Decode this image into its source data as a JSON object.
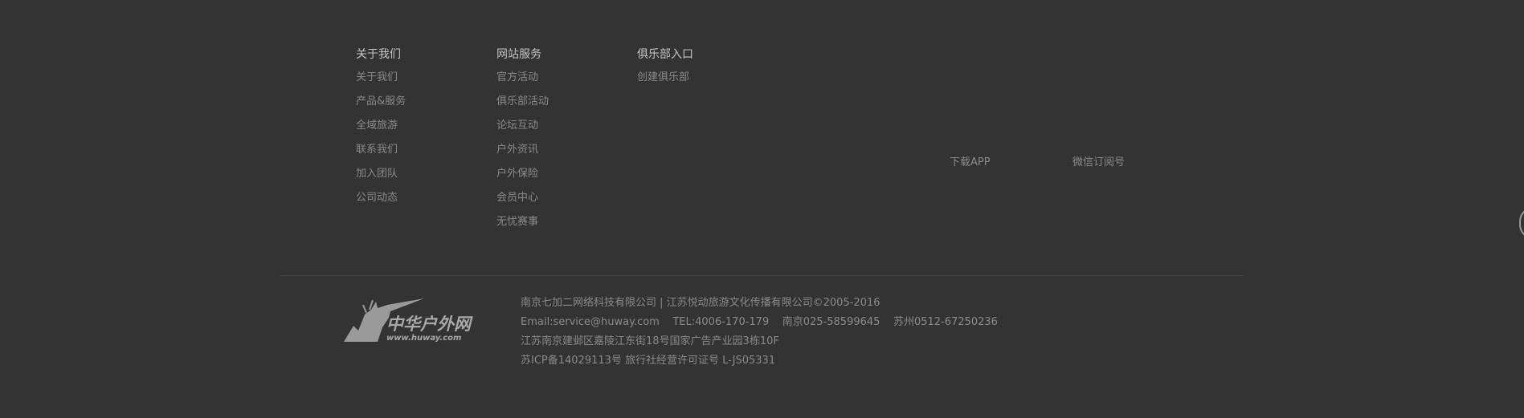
{
  "columns": {
    "about": {
      "title": "关于我们",
      "links": [
        "关于我们",
        "产品&服务",
        "全域旅游",
        "联系我们",
        "加入团队",
        "公司动态"
      ]
    },
    "service": {
      "title": "网站服务",
      "links": [
        "官方活动",
        "俱乐部活动",
        "论坛互动",
        "户外资讯",
        "户外保险",
        "会员中心",
        "无忧赛事"
      ]
    },
    "club": {
      "title": "俱乐部入口",
      "links": [
        "创建俱乐部"
      ]
    }
  },
  "apps": {
    "download": "下载APP",
    "wechat": "微信订阅号"
  },
  "logo": {
    "name": "中华户外网",
    "url": "www.huway.com"
  },
  "footer_info": {
    "company": "南京七加二网络科技有限公司 | 江苏悦动旅游文化传播有限公司©2005-2016",
    "contact": "Email:service@huway.com    TEL:4006-170-179    南京025-58599645    苏州0512-67250236",
    "address": "江苏南京建邺区嘉陵江东街18号国家广告产业园3栋10F",
    "license": "苏ICP备14029113号 旅行社经营许可证号 L-JS05331"
  }
}
